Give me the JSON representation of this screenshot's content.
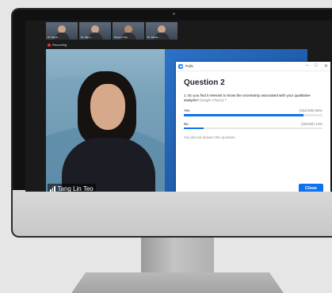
{
  "participants": [
    {
      "name": "Dr. Sarah ..."
    },
    {
      "name": "Dr. Nigel ..."
    },
    {
      "name": "Tang Lin Teo"
    },
    {
      "name": "Dr. Daniel ..."
    }
  ],
  "recording_label": "Recording",
  "active_speaker": {
    "name": "Tang Lin Teo"
  },
  "poll_window": {
    "title": "Polls",
    "controls": {
      "minimize": "–",
      "maximize": "□",
      "close": "✕"
    },
    "heading": "Question 2",
    "question": "1. Do you find it relevant to know the uncertainty associated with your qualitative analysis?",
    "question_type": "(Single Choice)",
    "required_mark": "*",
    "answers": [
      {
        "label": "Yes",
        "stats": "(154/180) 86%",
        "fraction": 0.86
      },
      {
        "label": "No",
        "stats": "(26/180) 14%",
        "fraction": 0.14
      }
    ],
    "note": "You did not answer this question",
    "close_button": "Close"
  },
  "colors": {
    "accent": "#0e72ed",
    "recording": "#e0333a"
  }
}
